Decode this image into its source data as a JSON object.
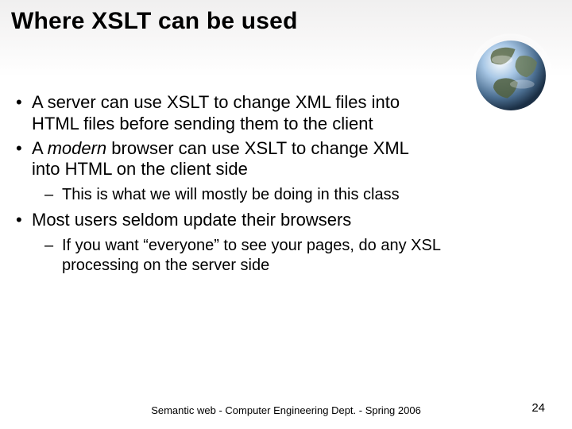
{
  "title": "Where XSLT can be used",
  "bullets": {
    "b1a": "A server can use XSLT to change XML files into",
    "b1b": "HTML files before sending them to the client",
    "b2a": "A ",
    "b2em": "modern",
    "b2b": " browser can use XSLT to change XML",
    "b2c": "into HTML on the client side",
    "b2s1": "This is what we will mostly be doing in this class",
    "b3": "Most users seldom update their browsers",
    "b3s1a": "If you want “everyone” to see your pages, do any XSL",
    "b3s1b": "processing on the server side"
  },
  "footer": "Semantic web - Computer Engineering Dept. - Spring 2006",
  "page": "24"
}
